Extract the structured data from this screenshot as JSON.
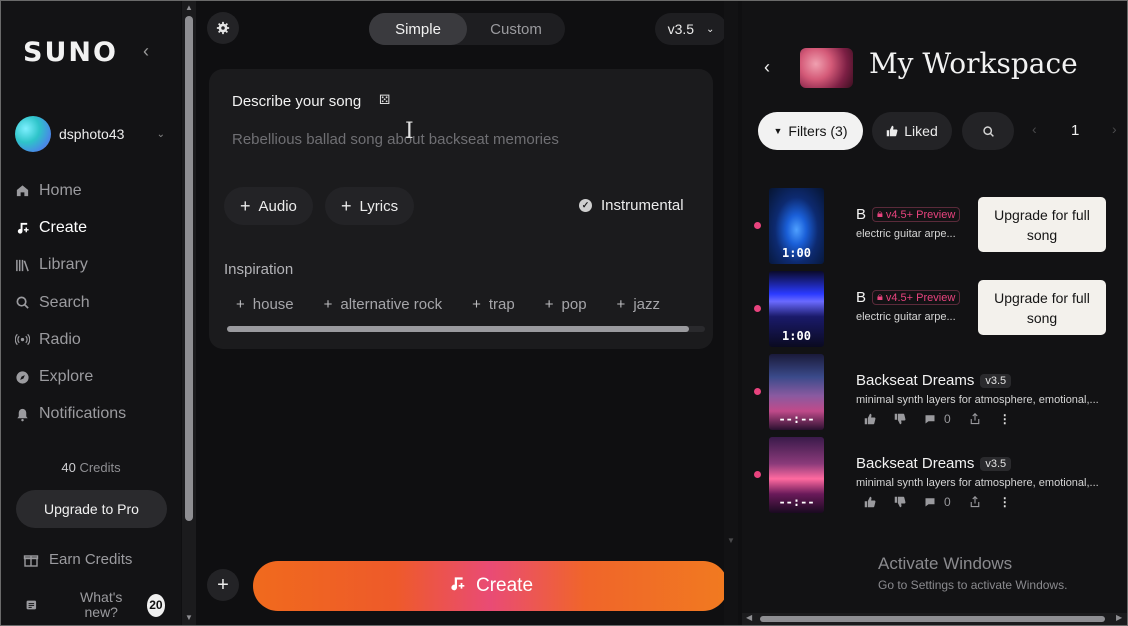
{
  "sidebar": {
    "logo": "SUNO",
    "username": "dsphoto43",
    "nav": [
      {
        "label": "Home",
        "icon": "home-icon"
      },
      {
        "label": "Create",
        "icon": "music-note-icon"
      },
      {
        "label": "Library",
        "icon": "library-icon"
      },
      {
        "label": "Search",
        "icon": "search-icon"
      },
      {
        "label": "Radio",
        "icon": "radio-icon"
      },
      {
        "label": "Explore",
        "icon": "compass-icon"
      },
      {
        "label": "Notifications",
        "icon": "bell-icon"
      }
    ],
    "credits_number": "40",
    "credits_label": "Credits",
    "upgrade_label": "Upgrade to Pro",
    "earn_label": "Earn Credits",
    "whats_new_label": "What's new?",
    "whats_new_count": "20"
  },
  "create": {
    "mode_simple": "Simple",
    "mode_custom": "Custom",
    "version": "v3.5",
    "describe_title": "Describe your song",
    "prompt_placeholder": "Rebellious ballad song about backseat memories",
    "audio_label": "Audio",
    "lyrics_label": "Lyrics",
    "instrumental_label": "Instrumental",
    "inspiration_label": "Inspiration",
    "tags": [
      "house",
      "alternative rock",
      "trap",
      "pop",
      "jazz"
    ],
    "create_label": "Create"
  },
  "workspace": {
    "title": "My Workspace",
    "filters_label": "Filters (3)",
    "liked_label": "Liked",
    "page": "1",
    "songs": [
      {
        "title": "B",
        "badge": "v4.5+ Preview",
        "desc": "electric guitar arpe...",
        "duration": "1:00",
        "upgrade": "Upgrade for full song"
      },
      {
        "title": "B",
        "badge": "v4.5+ Preview",
        "desc": "electric guitar arpe...",
        "duration": "1:00",
        "upgrade": "Upgrade for full song"
      },
      {
        "title": "Backseat Dreams",
        "badge": "v3.5",
        "desc": "minimal synth layers for atmosphere, emotional,...",
        "duration": "--:--",
        "comments": "0"
      },
      {
        "title": "Backseat Dreams",
        "badge": "v3.5",
        "desc": "minimal synth layers for atmosphere, emotional,...",
        "duration": "--:--",
        "comments": "0"
      }
    ]
  },
  "windows": {
    "activate_title": "Activate Windows",
    "activate_sub": "Go to Settings to activate Windows."
  },
  "colors": {
    "accent_pink": "#e8437e",
    "create_orange": "#f06a1d"
  }
}
